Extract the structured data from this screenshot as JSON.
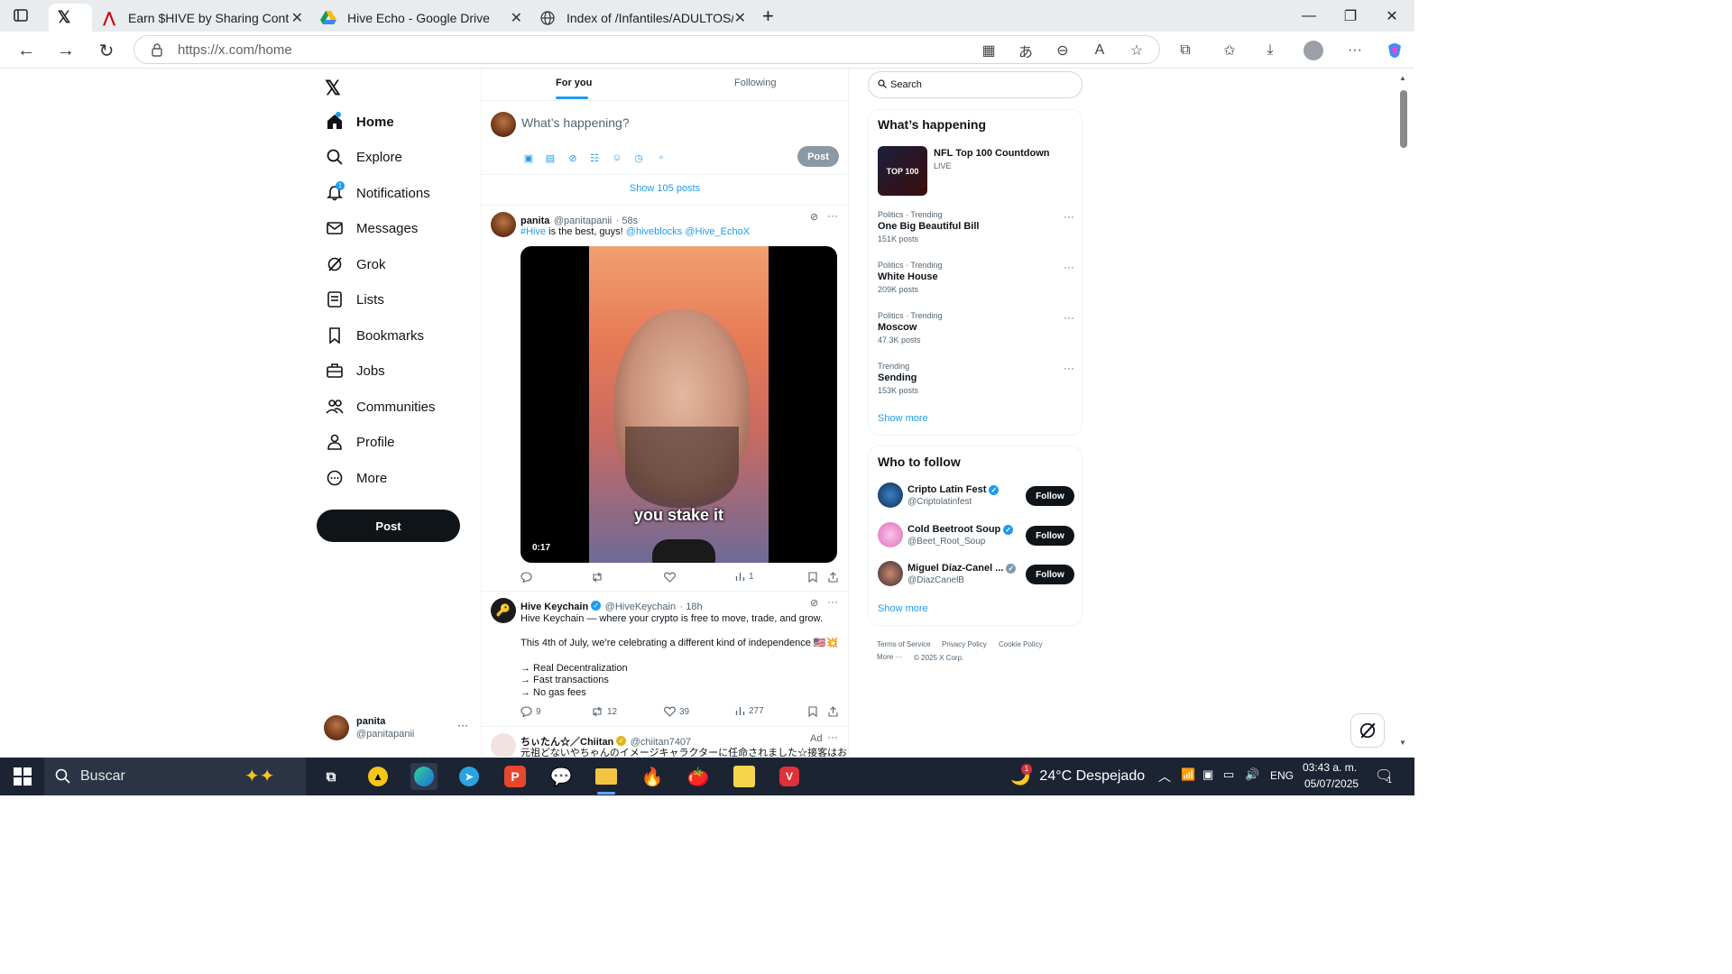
{
  "browser": {
    "tabs": [
      {
        "title": "",
        "icon": "x-logo"
      },
      {
        "title": "Earn $HIVE by Sharing Content #...",
        "icon": "peakd-icon"
      },
      {
        "title": "Hive Echo - Google Drive",
        "icon": "google-drive-icon"
      },
      {
        "title": "Index of /Infantiles/ADULTOS/Big...",
        "icon": "globe-icon"
      }
    ],
    "url": "https://x.com/home"
  },
  "nav": {
    "items": [
      {
        "label": "Home",
        "icon": "home-icon"
      },
      {
        "label": "Explore",
        "icon": "search-icon"
      },
      {
        "label": "Notifications",
        "icon": "bell-icon",
        "badge": "1"
      },
      {
        "label": "Messages",
        "icon": "mail-icon"
      },
      {
        "label": "Grok",
        "icon": "grok-icon"
      },
      {
        "label": "Lists",
        "icon": "list-icon"
      },
      {
        "label": "Bookmarks",
        "icon": "bookmark-icon"
      },
      {
        "label": "Jobs",
        "icon": "briefcase-icon"
      },
      {
        "label": "Communities",
        "icon": "people-icon"
      },
      {
        "label": "Profile",
        "icon": "person-icon"
      },
      {
        "label": "More",
        "icon": "more-circle-icon"
      }
    ],
    "post_label": "Post",
    "account": {
      "name": "panita",
      "handle": "@panitapanii"
    }
  },
  "feed": {
    "tabs": [
      "For you",
      "Following"
    ],
    "composer_placeholder": "What’s happening?",
    "composer_post": "Post",
    "show_posts": "Show 105 posts",
    "tweet1": {
      "name": "panita",
      "handle": "@panitapanii",
      "time": "· 58s",
      "hashtag": "#Hive",
      "text": " is the best, guys! ",
      "mentions": "@hiveblocks @Hive_EchoX",
      "video_caption": "you stake it",
      "video_time": "0:17",
      "views": "1"
    },
    "tweet2": {
      "name": "Hive Keychain",
      "handle": "@HiveKeychain",
      "time": "· 18h",
      "line1": "Hive Keychain — where your crypto is free to move, trade, and grow.",
      "line2": "This 4th of July, we’re celebrating a different kind of independence 🇺🇸💥",
      "bullets": [
        "→ Real Decentralization",
        "→ Fast transactions",
        "→ No gas fees"
      ],
      "replies": "9",
      "reposts": "12",
      "likes": "39",
      "views": "277"
    },
    "tweet3": {
      "name": "ちぃたん☆／Chiitan",
      "handle": "@chiitan7407",
      "ad": "Ad",
      "text": "元祖どないやちゃんのイメージキャラクターに任命されました☆接客はお"
    }
  },
  "sidebar": {
    "search_placeholder": "Search",
    "happening_title": "What’s happening",
    "live": {
      "title": "NFL Top 100 Countdown",
      "status": "LIVE",
      "thumb_text": "TOP 100"
    },
    "trends": [
      {
        "category": "Politics · Trending",
        "name": "One Big Beautiful Bill",
        "count": "151K posts"
      },
      {
        "category": "Politics · Trending",
        "name": "White House",
        "count": "209K posts"
      },
      {
        "category": "Politics · Trending",
        "name": "Moscow",
        "count": "47.3K posts"
      },
      {
        "category": "Trending",
        "name": "Sending",
        "count": "153K posts"
      }
    ],
    "show_more": "Show more",
    "follow_title": "Who to follow",
    "follow": [
      {
        "name": "Cripto Latin Fest",
        "handle": "@Criptolatinfest"
      },
      {
        "name": "Cold Beetroot Soup",
        "handle": "@Beet_Root_Soup"
      },
      {
        "name": "Miguel Díaz-Canel ...",
        "handle": "@DiazCanelB"
      }
    ],
    "follow_label": "Follow",
    "footer": [
      "Terms of Service",
      "Privacy Policy",
      "Cookie Policy",
      "More ···",
      "© 2025 X Corp."
    ]
  },
  "taskbar": {
    "search": "Buscar",
    "weather": "24°C  Despejado",
    "weather_badge": "1",
    "lang": "ENG",
    "time": "03:43 a. m.",
    "date": "05/07/2025",
    "notif_count": "1"
  },
  "colors": {
    "accent": "#1d9bf0",
    "text": "#0f1419",
    "muted": "#536471",
    "taskbar": "#1c2433"
  }
}
